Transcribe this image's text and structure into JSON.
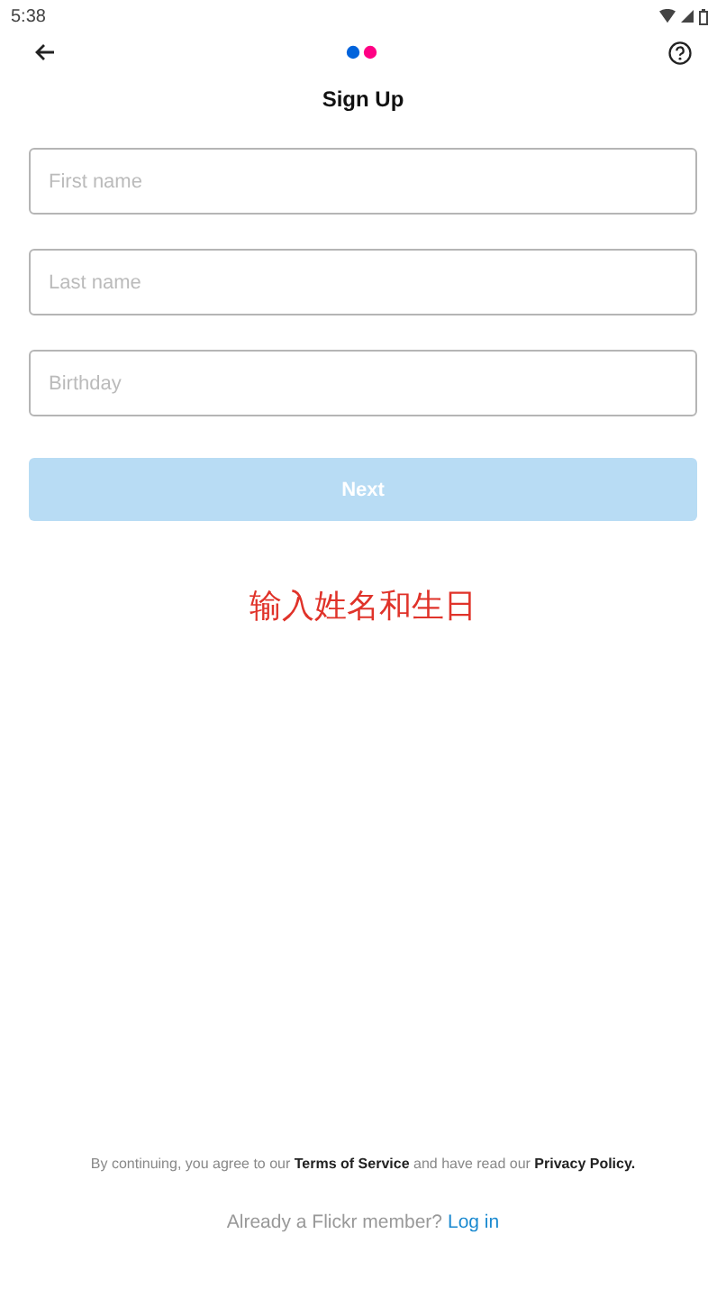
{
  "status_bar": {
    "time": "5:38"
  },
  "header": {
    "title": "Sign Up"
  },
  "fields": [
    {
      "placeholder": "First name"
    },
    {
      "placeholder": "Last name"
    },
    {
      "placeholder": "Birthday"
    }
  ],
  "next_button": {
    "label": "Next",
    "disabled": true
  },
  "annotation": "输入姓名和生日",
  "terms": "By continuing, you agree to our **Terms of Service** and have read our **Privacy Policy.**",
  "login_prompt": {
    "text": "Already a Flickr member?",
    "link": "Log in"
  }
}
